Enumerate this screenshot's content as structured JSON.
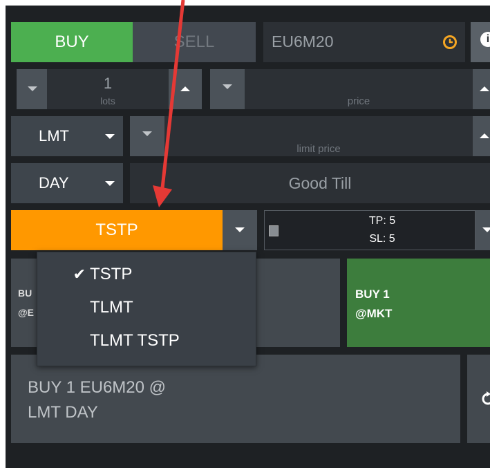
{
  "side_tabs": {
    "buy": "BUY",
    "sell": "SELL"
  },
  "symbol": {
    "value": "EU6M20",
    "icon": "clock-icon"
  },
  "quantity": {
    "value": "1",
    "unit": "lots"
  },
  "price": {
    "label": "price"
  },
  "limit_price": {
    "label": "limit price"
  },
  "order_type": {
    "selected": "LMT"
  },
  "tif": {
    "selected": "DAY",
    "good_till_placeholder": "Good Till"
  },
  "trailing": {
    "selected": "TSTP",
    "options": [
      "TSTP",
      "TLMT",
      "TLMT TSTP"
    ],
    "checked_index": 0
  },
  "bracket": {
    "tp": "TP: 5",
    "sl": "SL: 5"
  },
  "quick_buttons": {
    "left": {
      "line1": "BU",
      "line2": "@E"
    },
    "right": {
      "line1": "BUY 1",
      "line2": "@MKT"
    }
  },
  "summary": {
    "line1": "BUY 1 EU6M20 @",
    "line2": "LMT DAY"
  },
  "colors": {
    "buy": "#4caf50",
    "trailing": "#ff9800",
    "market_buy": "#3d7d3d",
    "clock": "#f5a623",
    "arrow": "#e53935"
  }
}
